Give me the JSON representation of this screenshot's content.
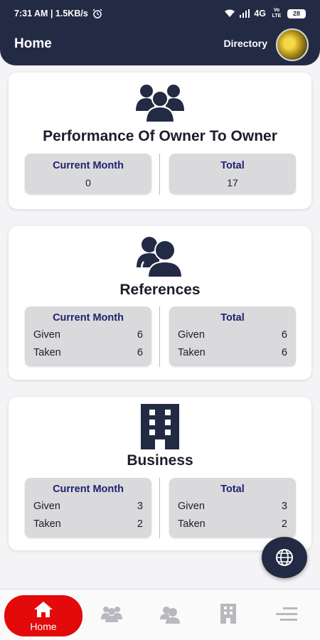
{
  "status_bar": {
    "time_speed": "7:31 AM | 1.5KB/s",
    "network": "4G",
    "volte": "Vo LTE",
    "battery": "28"
  },
  "header": {
    "title": "Home",
    "directory_label": "Directory"
  },
  "cards": {
    "owner": {
      "title": "Performance Of Owner To Owner",
      "current_month": {
        "label": "Current Month",
        "value": "0"
      },
      "total": {
        "label": "Total",
        "value": "17"
      }
    },
    "references": {
      "title": "References",
      "current_month": {
        "label": "Current Month",
        "given_label": "Given",
        "given": "6",
        "taken_label": "Taken",
        "taken": "6"
      },
      "total": {
        "label": "Total",
        "given_label": "Given",
        "given": "6",
        "taken_label": "Taken",
        "taken": "6"
      }
    },
    "business": {
      "title": "Business",
      "current_month": {
        "label": "Current Month",
        "given_label": "Given",
        "given": "3",
        "taken_label": "Taken",
        "taken": "2"
      },
      "total": {
        "label": "Total",
        "given_label": "Given",
        "given": "3",
        "taken_label": "Taken",
        "taken": "2"
      }
    }
  },
  "bottom_nav": {
    "home_label": "Home",
    "items": [
      "members-icon",
      "references-icon",
      "business-icon",
      "menu-icon"
    ]
  },
  "colors": {
    "navy": "#232a44",
    "accent_red": "#e20a0a",
    "stat_box": "#dadadd",
    "stat_head": "#21216e"
  }
}
